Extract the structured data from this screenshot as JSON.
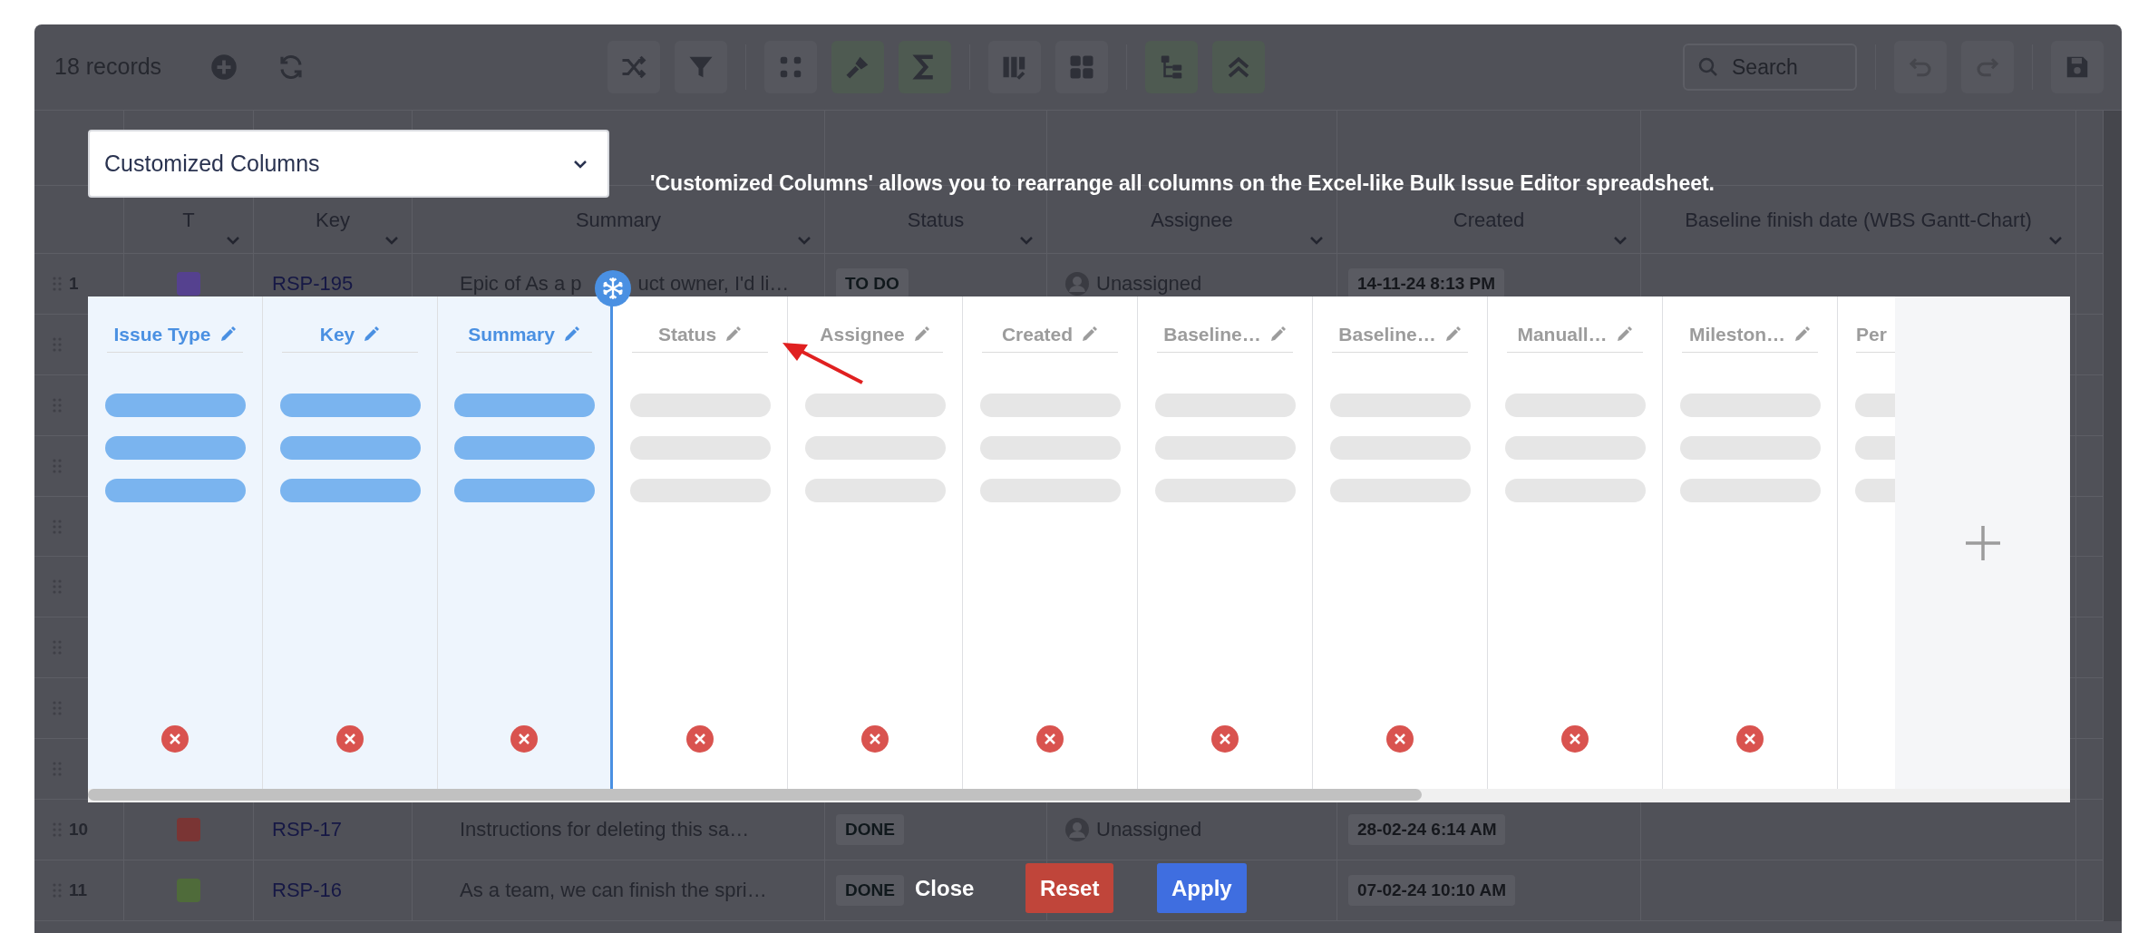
{
  "toolbar": {
    "record_count": "18 records",
    "actions": [
      {
        "kind": "add"
      },
      {
        "kind": "refresh"
      }
    ],
    "groups": [
      [
        {
          "kind": "shuffle",
          "tinted": false
        },
        {
          "kind": "filter",
          "tinted": false
        }
      ],
      [
        {
          "kind": "dots",
          "tinted": false
        },
        {
          "kind": "brush",
          "tinted": true
        },
        {
          "kind": "sigma",
          "tinted": true
        }
      ],
      [
        {
          "kind": "columns",
          "tinted": false
        },
        {
          "kind": "grid",
          "tinted": false
        }
      ],
      [
        {
          "kind": "tree",
          "tinted": true
        },
        {
          "kind": "chevrons",
          "tinted": true
        }
      ],
      [
        {
          "kind": "undo",
          "tinted": false
        },
        {
          "kind": "redo",
          "tinted": false
        }
      ],
      [
        {
          "kind": "save",
          "tinted": false
        }
      ]
    ],
    "search": {
      "placeholder": "Search"
    }
  },
  "table": {
    "columns": [
      "T",
      "Key",
      "Summary",
      "Status",
      "Assignee",
      "Created",
      "Baseline finish date (WBS Gantt-Chart)"
    ],
    "rows": [
      {
        "kind": "full",
        "number": "1",
        "color": "#55418f",
        "key": "RSP-195",
        "summary": [
          "Epic of As a p",
          "uct owner, I'd li…"
        ],
        "status": "TO DO",
        "assignee": "Unassigned",
        "created": "14-11-24 8:13 PM"
      },
      {
        "kind": "covered"
      },
      {
        "kind": "covered"
      },
      {
        "kind": "covered"
      },
      {
        "kind": "covered"
      },
      {
        "kind": "covered"
      },
      {
        "kind": "covered"
      },
      {
        "kind": "covered"
      },
      {
        "kind": "covered"
      },
      {
        "kind": "full",
        "number": "10",
        "color": "#7a3534",
        "key": "RSP-17",
        "summary": [
          "Instructions for deleting this sa…"
        ],
        "status": "DONE",
        "assignee": "Unassigned",
        "created": "28-02-24 6:14 AM"
      },
      {
        "kind": "full",
        "number": "11",
        "color": "#4f6b3a",
        "key": "RSP-16",
        "summary": [
          "As a team, we can finish the spri…"
        ],
        "status": "DONE",
        "created": "07-02-24 10:10 AM"
      }
    ]
  },
  "dialog": {
    "view_select": "Customized Columns",
    "info": "'Customized Columns' allows you to rearrange all columns on the Excel-like Bulk Issue Editor spreadsheet.",
    "columns": [
      {
        "label": "Issue Type",
        "frozen": true,
        "removable": true
      },
      {
        "label": "Key",
        "frozen": true,
        "removable": true
      },
      {
        "label": "Summary",
        "frozen": true,
        "removable": true
      },
      {
        "label": "Status",
        "frozen": false,
        "removable": true
      },
      {
        "label": "Assignee",
        "frozen": false,
        "removable": true
      },
      {
        "label": "Created",
        "frozen": false,
        "removable": true
      },
      {
        "label": "Baseline…",
        "frozen": false,
        "removable": true
      },
      {
        "label": "Baseline…",
        "frozen": false,
        "removable": true
      },
      {
        "label": "Manuall…",
        "frozen": false,
        "removable": true
      },
      {
        "label": "Mileston…",
        "frozen": false,
        "removable": true
      },
      {
        "label": "Per",
        "frozen": false
      }
    ],
    "buttons": [
      {
        "kind": "close",
        "label": "Close"
      },
      {
        "kind": "reset",
        "label": "Reset"
      },
      {
        "kind": "apply",
        "label": "Apply"
      }
    ]
  }
}
